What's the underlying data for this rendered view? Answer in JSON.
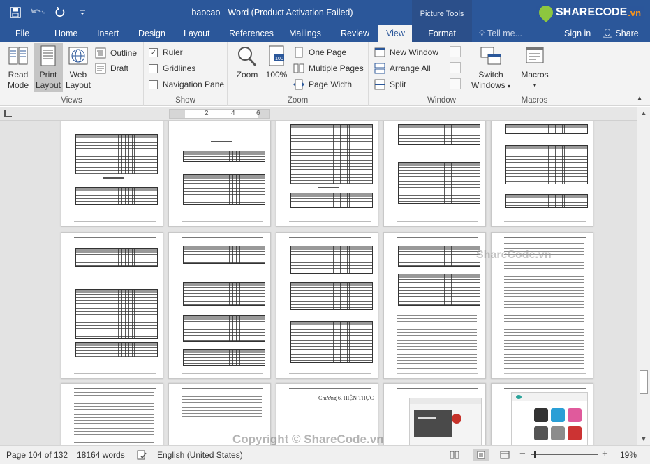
{
  "titlebar": {
    "title": "baocao - Word (Product Activation Failed)",
    "context_group": "Picture Tools",
    "logo_text": "SHARECODE",
    "logo_tld": ".vn"
  },
  "tabs": [
    "File",
    "Home",
    "Insert",
    "Design",
    "Layout",
    "References",
    "Mailings",
    "Review",
    "View",
    "Format"
  ],
  "active_tab": "View",
  "tell_me": "Tell me...",
  "sign_in": "Sign in",
  "share": "Share",
  "ribbon": {
    "views": {
      "label": "Views",
      "read_mode": [
        "Read",
        "Mode"
      ],
      "print_layout": [
        "Print",
        "Layout"
      ],
      "web_layout": [
        "Web",
        "Layout"
      ],
      "outline": "Outline",
      "draft": "Draft"
    },
    "show": {
      "label": "Show",
      "ruler": "Ruler",
      "ruler_checked": true,
      "gridlines": "Gridlines",
      "gridlines_checked": false,
      "navigation_pane": "Navigation Pane",
      "navigation_checked": false
    },
    "zoom": {
      "label": "Zoom",
      "zoom": "Zoom",
      "hundred": "100%",
      "one_page": "One Page",
      "multiple_pages": "Multiple Pages",
      "page_width": "Page Width"
    },
    "window": {
      "label": "Window",
      "new_window": "New Window",
      "arrange_all": "Arrange All",
      "split": "Split",
      "switch_windows": [
        "Switch",
        "Windows"
      ]
    },
    "macros": {
      "label": "Macros",
      "macros": "Macros"
    }
  },
  "ruler": {
    "marks": [
      "2",
      "4",
      "6"
    ]
  },
  "document": {
    "chapter_title": "Chương 6. HIỆN THỰC"
  },
  "watermarks": {
    "bottom": "Copyright © ShareCode.vn",
    "middle": "ShareCode.vn"
  },
  "status": {
    "page": "Page 104 of 132",
    "words": "18164 words",
    "language": "English (United States)",
    "zoom": "19%",
    "zoom_fraction": 0.19
  },
  "colors": {
    "accent": "#2b579a",
    "ribbon_bg": "#f3f3f3"
  }
}
